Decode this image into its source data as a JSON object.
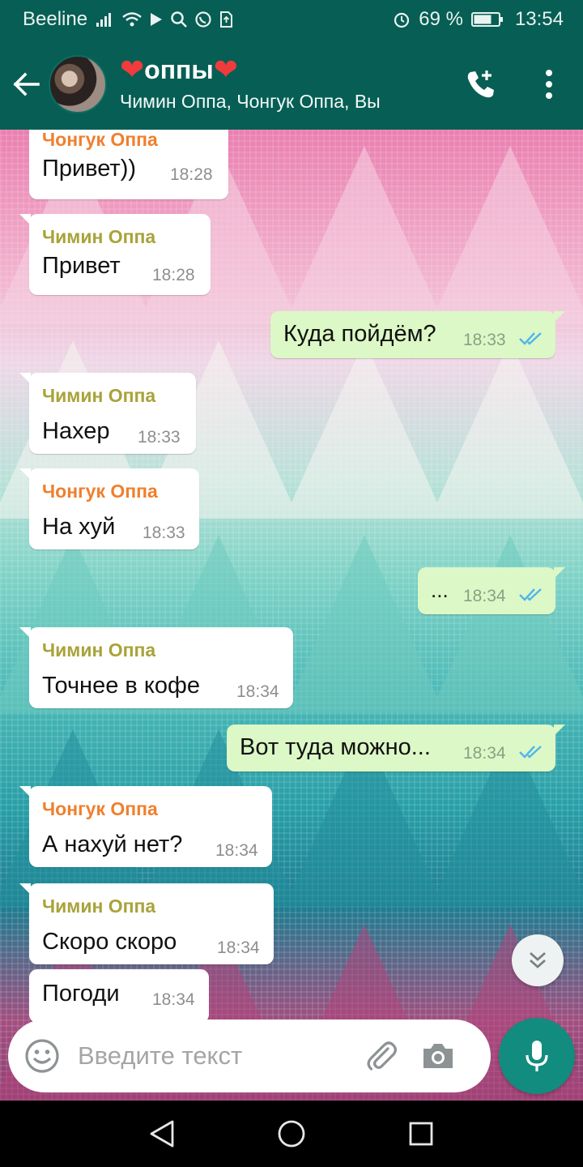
{
  "status_bar": {
    "carrier": "Beeline",
    "battery": "69 %",
    "time": "13:54",
    "icons": [
      "signal-icon",
      "wifi-icon",
      "play-icon",
      "search-icon",
      "whatsapp-icon",
      "sim-icon",
      "alarm-icon",
      "battery-icon"
    ]
  },
  "header": {
    "title": "оппы",
    "title_decoration": "heart",
    "subtitle": "Чимин Оппа, Чонгук Оппа, Вы",
    "color": "#075e54"
  },
  "messages": [
    {
      "direction": "in",
      "sender": "Чонгук Оппа",
      "text": "Привет))",
      "time": "18:28"
    },
    {
      "direction": "in",
      "sender": "Чимин Оппа",
      "text": "Привет",
      "time": "18:28"
    },
    {
      "direction": "out",
      "text": "Куда пойдём?",
      "time": "18:33",
      "status": "read"
    },
    {
      "direction": "in",
      "sender": "Чимин Оппа",
      "text": "Нахер",
      "time": "18:33"
    },
    {
      "direction": "in",
      "sender": "Чонгук Оппа",
      "text": "На хуй",
      "time": "18:33"
    },
    {
      "direction": "out",
      "text": "...",
      "time": "18:34",
      "status": "read"
    },
    {
      "direction": "in",
      "sender": "Чимин Оппа",
      "text": "Точнее в кофе",
      "time": "18:34"
    },
    {
      "direction": "out",
      "text": "Вот туда можно...",
      "time": "18:34",
      "status": "read"
    },
    {
      "direction": "in",
      "sender": "Чонгук Оппа",
      "text": "А нахуй нет?",
      "time": "18:34"
    },
    {
      "direction": "in",
      "sender": "Чимин Оппа",
      "text": "Скоро скоро",
      "time": "18:34"
    },
    {
      "direction": "in",
      "text": "Погоди",
      "time": "18:34"
    }
  ],
  "composer": {
    "placeholder": "Введите текст"
  },
  "colors": {
    "accent": "#128c7e",
    "outgoing_bubble": "#dcf8c6",
    "incoming_bubble": "#ffffff",
    "read_ticks": "#4fb6ec",
    "sender_chongguk": "#f07f2e",
    "sender_jimin": "#a9a33a"
  }
}
